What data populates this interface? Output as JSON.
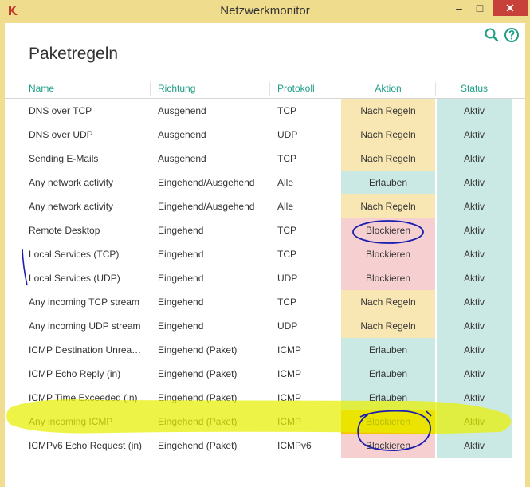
{
  "window": {
    "title": "Netzwerkmonitor",
    "minimize_glyph": "–",
    "maximize_glyph": "□",
    "close_glyph": "✕",
    "icons": [
      "app-logo-icon",
      "search-icon",
      "help-icon"
    ]
  },
  "page": {
    "title": "Paketregeln"
  },
  "columns": {
    "name": "Name",
    "direction": "Richtung",
    "protocol": "Protokoll",
    "action": "Aktion",
    "status": "Status"
  },
  "rows": [
    {
      "name": "DNS over TCP",
      "direction": "Ausgehend",
      "protocol": "TCP",
      "action": "Nach Regeln",
      "status": "Aktiv"
    },
    {
      "name": "DNS over UDP",
      "direction": "Ausgehend",
      "protocol": "UDP",
      "action": "Nach Regeln",
      "status": "Aktiv"
    },
    {
      "name": "Sending E-Mails",
      "direction": "Ausgehend",
      "protocol": "TCP",
      "action": "Nach Regeln",
      "status": "Aktiv"
    },
    {
      "name": "Any network activity",
      "direction": "Eingehend/Ausgehend",
      "protocol": "Alle",
      "action": "Erlauben",
      "status": "Aktiv"
    },
    {
      "name": "Any network activity",
      "direction": "Eingehend/Ausgehend",
      "protocol": "Alle",
      "action": "Nach Regeln",
      "status": "Aktiv"
    },
    {
      "name": "Remote Desktop",
      "direction": "Eingehend",
      "protocol": "TCP",
      "action": "Blockieren",
      "status": "Aktiv"
    },
    {
      "name": "Local Services (TCP)",
      "direction": "Eingehend",
      "protocol": "TCP",
      "action": "Blockieren",
      "status": "Aktiv"
    },
    {
      "name": "Local Services (UDP)",
      "direction": "Eingehend",
      "protocol": "UDP",
      "action": "Blockieren",
      "status": "Aktiv"
    },
    {
      "name": "Any incoming TCP stream",
      "direction": "Eingehend",
      "protocol": "TCP",
      "action": "Nach Regeln",
      "status": "Aktiv"
    },
    {
      "name": "Any incoming UDP stream",
      "direction": "Eingehend",
      "protocol": "UDP",
      "action": "Nach Regeln",
      "status": "Aktiv"
    },
    {
      "name": "ICMP Destination Unrea…",
      "direction": "Eingehend (Paket)",
      "protocol": "ICMP",
      "action": "Erlauben",
      "status": "Aktiv"
    },
    {
      "name": "ICMP Echo Reply (in)",
      "direction": "Eingehend (Paket)",
      "protocol": "ICMP",
      "action": "Erlauben",
      "status": "Aktiv"
    },
    {
      "name": "ICMP Time Exceeded (in)",
      "direction": "Eingehend (Paket)",
      "protocol": "ICMP",
      "action": "Erlauben",
      "status": "Aktiv"
    },
    {
      "name": "Any incoming ICMP",
      "direction": "Eingehend (Paket)",
      "protocol": "ICMP",
      "action": "Blockieren",
      "status": "Aktiv"
    },
    {
      "name": "ICMPv6 Echo Request (in)",
      "direction": "Eingehend (Paket)",
      "protocol": "ICMPv6",
      "action": "Blockieren",
      "status": "Aktiv"
    }
  ],
  "colors": {
    "header_text": "#1f9e86",
    "action_by_rules": "#f9e7b3",
    "action_allow": "#cbe9e4",
    "action_block": "#f6cfd0",
    "status_active": "#cbe9e4",
    "highlight_marker": "#e6f000",
    "pen_annotation": "#1a1fb0"
  }
}
